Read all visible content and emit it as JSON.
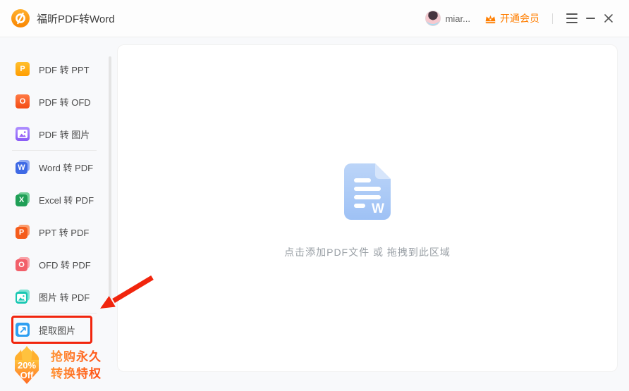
{
  "colors": {
    "accent_orange": "#ff7e00",
    "annotation_red": "#f1250d",
    "promo_text_start": "#ff9232",
    "promo_text_end": "#ff4f13",
    "doc_icon_blue": "#a9c9f5"
  },
  "titlebar": {
    "app_title": "福昕PDF转Word",
    "user_name": "miar...",
    "vip_label": "开通会员"
  },
  "sidebar": {
    "items": [
      {
        "label": "PDF 转 PPT",
        "letter": "P"
      },
      {
        "label": "PDF 转 OFD",
        "letter": "O"
      },
      {
        "label": "PDF 转 图片",
        "letter": ""
      },
      {
        "label": "Word 转 PDF",
        "letter": "W"
      },
      {
        "label": "Excel 转 PDF",
        "letter": "X"
      },
      {
        "label": "PPT 转 PDF",
        "letter": "P"
      },
      {
        "label": "OFD 转 PDF",
        "letter": "O"
      },
      {
        "label": "图片 转 PDF",
        "letter": ""
      },
      {
        "label": "提取图片",
        "letter": "",
        "highlighted": true
      }
    ],
    "promo": {
      "discount_line1": "20%",
      "discount_line2": "Off",
      "label_line1": "抢购永久",
      "label_line2": "转换特权"
    }
  },
  "main": {
    "dropzone_hint": "点击添加PDF文件 或 拖拽到此区域"
  }
}
